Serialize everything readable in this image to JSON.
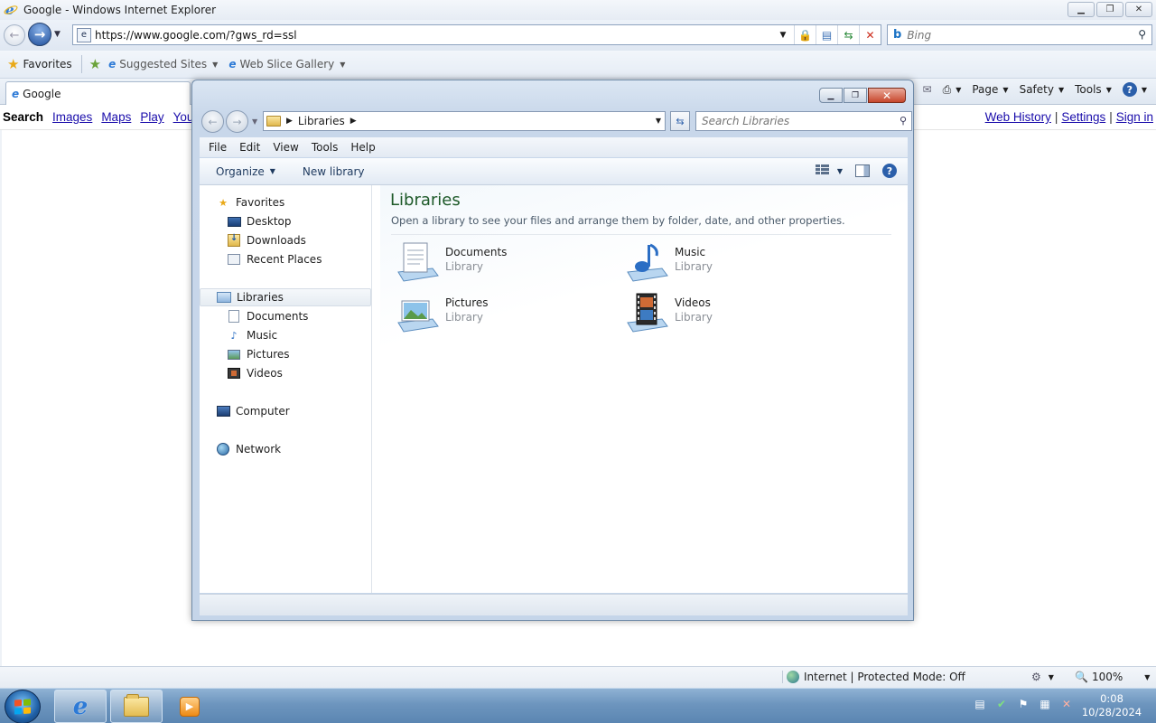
{
  "ie": {
    "title": "Google - Windows Internet Explorer",
    "address": "https://www.google.com/?gws_rd=ssl",
    "search_placeholder": "Bing",
    "favorites_label": "Favorites",
    "suggested_sites": "Suggested Sites",
    "web_slice_gallery": "Web Slice Gallery",
    "tab_title": "Google",
    "commands": {
      "page": "Page",
      "safety": "Safety",
      "tools": "Tools"
    },
    "status_zone": "Internet | Protected Mode: Off",
    "zoom": "100%"
  },
  "google_bar": {
    "left": [
      "Search",
      "Images",
      "Maps",
      "Play",
      "You"
    ],
    "right": [
      "Web History",
      "Settings",
      "Sign in"
    ]
  },
  "explorer": {
    "breadcrumb": "Libraries",
    "search_placeholder": "Search Libraries",
    "menu": [
      "File",
      "Edit",
      "View",
      "Tools",
      "Help"
    ],
    "toolbar": {
      "organize": "Organize",
      "new_library": "New library"
    },
    "nav": {
      "favorites": "Favorites",
      "desktop": "Desktop",
      "downloads": "Downloads",
      "recent_places": "Recent Places",
      "libraries": "Libraries",
      "documents": "Documents",
      "music": "Music",
      "pictures": "Pictures",
      "videos": "Videos",
      "computer": "Computer",
      "network": "Network"
    },
    "content": {
      "title": "Libraries",
      "subtitle": "Open a library to see your files and arrange them by folder, date, and other properties.",
      "items": [
        {
          "name": "Documents",
          "type": "Library"
        },
        {
          "name": "Music",
          "type": "Library"
        },
        {
          "name": "Pictures",
          "type": "Library"
        },
        {
          "name": "Videos",
          "type": "Library"
        }
      ]
    }
  },
  "taskbar": {
    "time": "0:08",
    "date": "10/28/2024"
  }
}
